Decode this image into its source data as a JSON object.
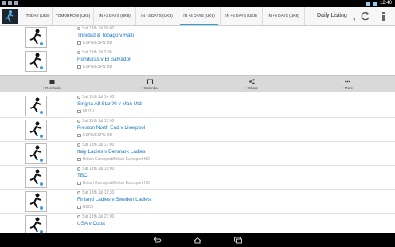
{
  "status_bar": {
    "time": "12:40"
  },
  "app": {
    "tabs": [
      {
        "label": "TODAY (UK8)",
        "active": false
      },
      {
        "label": "TOMORROW (UK8)",
        "active": false
      },
      {
        "label": "IN +2 DAYS (UK8)",
        "active": false
      },
      {
        "label": "IN +3 DAYS (UK8)",
        "active": false
      },
      {
        "label": "IN +4 DAYS (UK8)",
        "active": true
      },
      {
        "label": "IN +5 DAYS (UK8)",
        "active": false
      },
      {
        "label": "IN +6 DAYS (UK8)",
        "active": false
      }
    ],
    "dropdown_label": "Daily Listing",
    "accent": "#2d9fd9"
  },
  "events": [
    {
      "date": "Sat 13th Jul 00:00",
      "title": "Trinidad & Tobago v Haiti",
      "channel": "ESPN/ESPN HD"
    },
    {
      "date": "Sat 13th Jul 2:30",
      "title": "Honduras v El Salvador",
      "channel": "ESPN/ESPN HD"
    },
    {
      "date": "Sat 13th Jul 14:00",
      "title": "Singha All Star XI v Man Utd",
      "channel": "MUTV"
    },
    {
      "date": "Sat 13th Jul 15:00",
      "title": "Preston North End v Liverpool",
      "channel": "ESPN/ESPN HD"
    },
    {
      "date": "Sat 13th Jul 17:00",
      "title": "Italy Ladies v Denmark Ladies",
      "channel": "British Eurosport/British Eurosport HD"
    },
    {
      "date": "Sat 13th Jul 19:00",
      "title": "TBC",
      "channel": "British Eurosport/British Eurosport HD"
    },
    {
      "date": "Sat 13th Jul 19:30",
      "title": "Finland Ladies v Sweden Ladies",
      "channel": "BBC3"
    },
    {
      "date": "Sat 13th Jul 21:00",
      "title": "USA v Cuba",
      "channel": ""
    }
  ],
  "actions": {
    "reminder": "+ Reminder",
    "calendar": "+ Calendar",
    "share": "+ Share",
    "more": "+ More"
  }
}
